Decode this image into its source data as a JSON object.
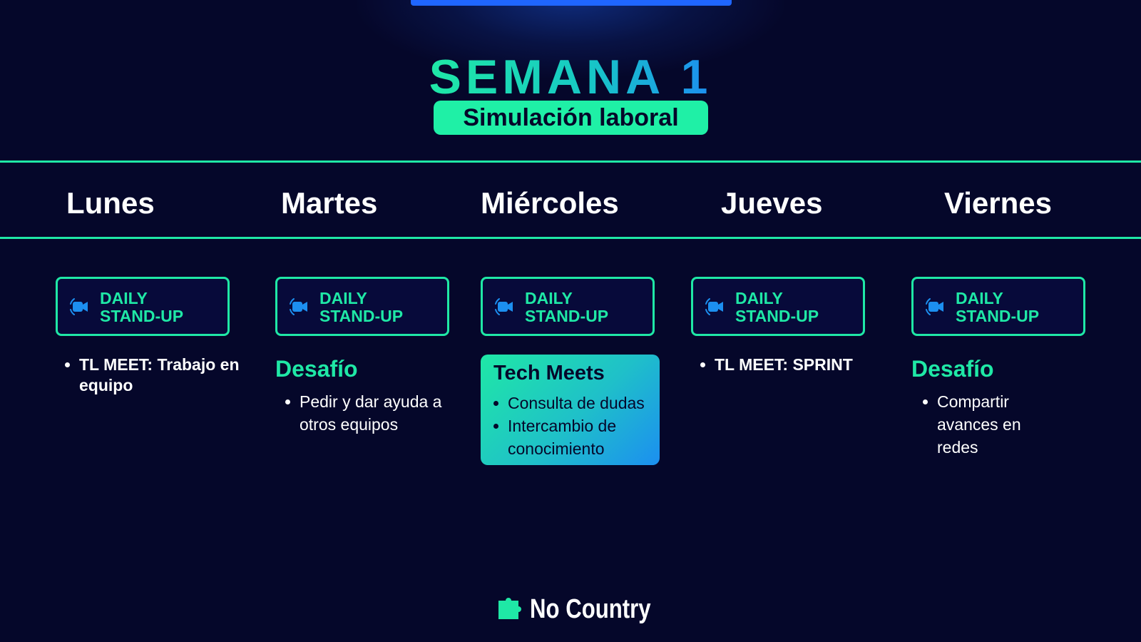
{
  "header": {
    "title": "SEMANA 1",
    "subtitle": "Simulación laboral"
  },
  "days": [
    {
      "name": "Lunes"
    },
    {
      "name": "Martes"
    },
    {
      "name": "Miércoles"
    },
    {
      "name": "Jueves"
    },
    {
      "name": "Viernes"
    }
  ],
  "standup": {
    "label": "DAILY\nSTAND-UP",
    "icon": "video-camera-icon"
  },
  "lunes": {
    "items": [
      "TL MEET: Trabajo en equipo"
    ]
  },
  "martes": {
    "heading": "Desafío",
    "items": [
      "Pedir y dar ayuda a otros equipos"
    ]
  },
  "miercoles": {
    "card_title": "Tech Meets",
    "items": [
      "Consulta de dudas",
      "Intercambio de conocimiento"
    ]
  },
  "jueves": {
    "items": [
      "TL MEET: SPRINT"
    ]
  },
  "viernes": {
    "heading": "Desafío",
    "items": [
      "Compartir avances en redes"
    ]
  },
  "brand": {
    "name": "No Country",
    "icon": "puzzle-logo-icon"
  },
  "colors": {
    "background": "#05072a",
    "accent": "#1fe8a6",
    "blue": "#1c8ff0",
    "top_bar": "#1f66ff"
  }
}
